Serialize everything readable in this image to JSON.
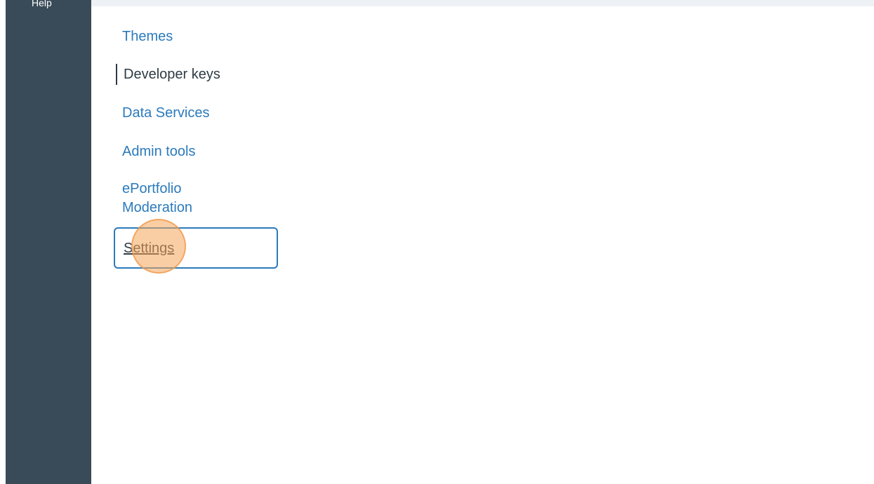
{
  "global_nav": {
    "partial_item": "Help"
  },
  "sub_nav": {
    "items": [
      {
        "label": "Themes",
        "state": "link"
      },
      {
        "label": "Developer keys",
        "state": "active"
      },
      {
        "label": "Data Services",
        "state": "link"
      },
      {
        "label": "Admin tools",
        "state": "link"
      },
      {
        "label": "ePortfolio Moderation",
        "state": "link"
      },
      {
        "label": "Settings",
        "state": "focused"
      }
    ]
  },
  "colors": {
    "nav_background": "#394b58",
    "link": "#2b7abc",
    "active_text": "#2d3b45",
    "focus_outline": "#2b7abc",
    "click_marker": "#f5a65a",
    "top_strip": "#eef1f5"
  }
}
